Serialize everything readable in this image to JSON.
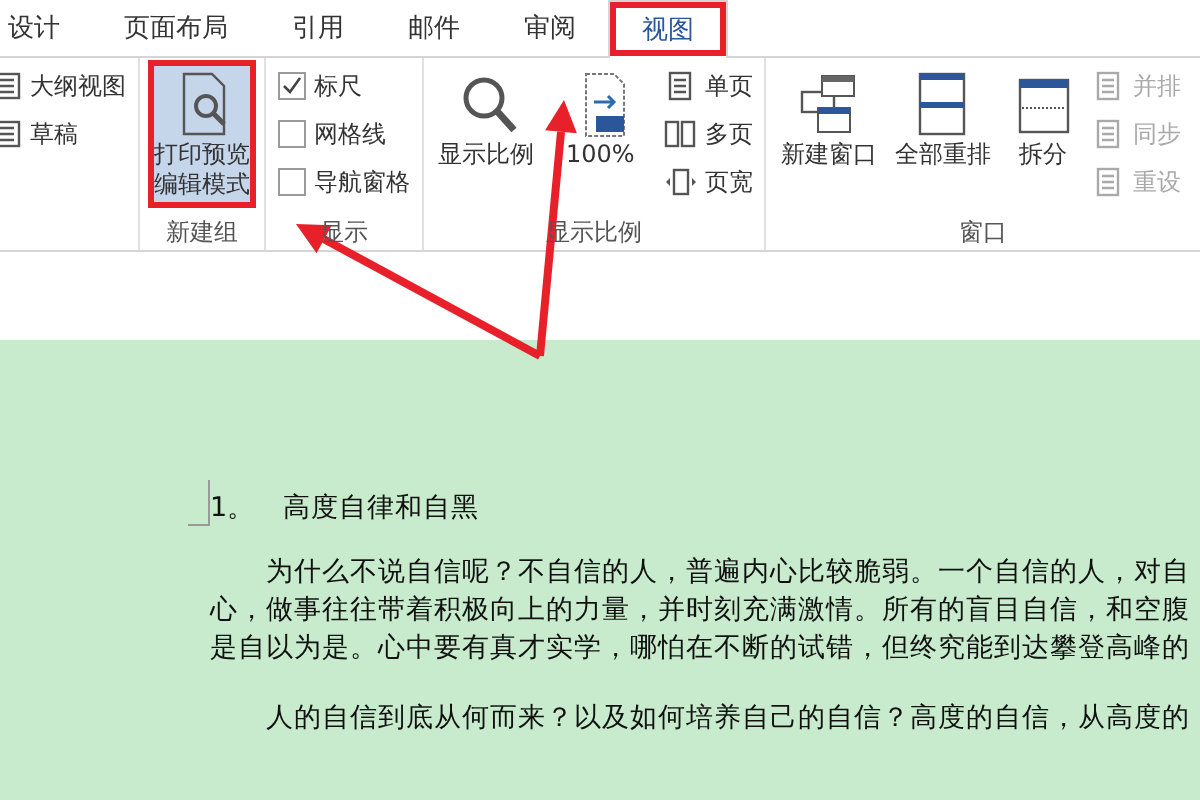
{
  "tabs": [
    {
      "label": "设计",
      "selected": false
    },
    {
      "label": "页面布局",
      "selected": false
    },
    {
      "label": "引用",
      "selected": false
    },
    {
      "label": "邮件",
      "selected": false
    },
    {
      "label": "审阅",
      "selected": false
    },
    {
      "label": "视图",
      "selected": true
    }
  ],
  "ribbon": [
    {
      "columns": [
        [
          {
            "kind": "small",
            "label": "大纲视图",
            "disabled": false
          },
          {
            "kind": "small",
            "label": "草稿",
            "disabled": false
          }
        ]
      ]
    },
    {
      "label": "新建组",
      "columns": [
        [
          {
            "kind": "large",
            "lines": [
              "打印预览",
              "编辑模式"
            ],
            "selected": true
          }
        ]
      ]
    },
    {
      "label": "显示",
      "columns": [
        [
          {
            "kind": "check",
            "label": "标尺",
            "checked": true
          },
          {
            "kind": "check",
            "label": "网格线",
            "checked": false
          },
          {
            "kind": "check",
            "label": "导航窗格",
            "checked": false
          }
        ]
      ]
    },
    {
      "label": "显示比例",
      "columns": [
        [
          {
            "kind": "large",
            "lines": [
              "显示比例"
            ],
            "selected": false
          }
        ],
        [
          {
            "kind": "large",
            "lines": [
              "100%"
            ],
            "selected": false
          }
        ],
        [
          {
            "kind": "small",
            "label": "单页",
            "disabled": false
          },
          {
            "kind": "small",
            "label": "多页",
            "disabled": false
          },
          {
            "kind": "small",
            "label": "页宽",
            "disabled": false
          }
        ]
      ]
    },
    {
      "label": "窗口",
      "columns": [
        [
          {
            "kind": "large",
            "lines": [
              "新建窗口"
            ],
            "selected": false
          }
        ],
        [
          {
            "kind": "large",
            "lines": [
              "全部重排"
            ],
            "selected": false
          }
        ],
        [
          {
            "kind": "large",
            "lines": [
              "拆分"
            ],
            "selected": false
          }
        ],
        [
          {
            "kind": "small",
            "label": "并排",
            "disabled": true
          },
          {
            "kind": "small",
            "label": "同步",
            "disabled": true
          },
          {
            "kind": "small",
            "label": "重设",
            "disabled": true
          }
        ]
      ]
    }
  ],
  "document": {
    "heading_number": "1。",
    "heading": "高度自律和自黑",
    "paragraphs": [
      {
        "lines": [
          "为什么不说自信呢？不自信的人，普遍内心比较脆弱。一个自信的人，对自",
          "心，做事往往带着积极向上的力量，并时刻充满激情。所有的盲目自信，和空腹",
          "是自以为是。心中要有真才实学，哪怕在不断的试错，但终究能到达攀登高峰的"
        ]
      },
      {
        "lines": [
          "人的自信到底从何而来？以及如何培养自己的自信？高度的自信，从高度的"
        ]
      }
    ]
  }
}
